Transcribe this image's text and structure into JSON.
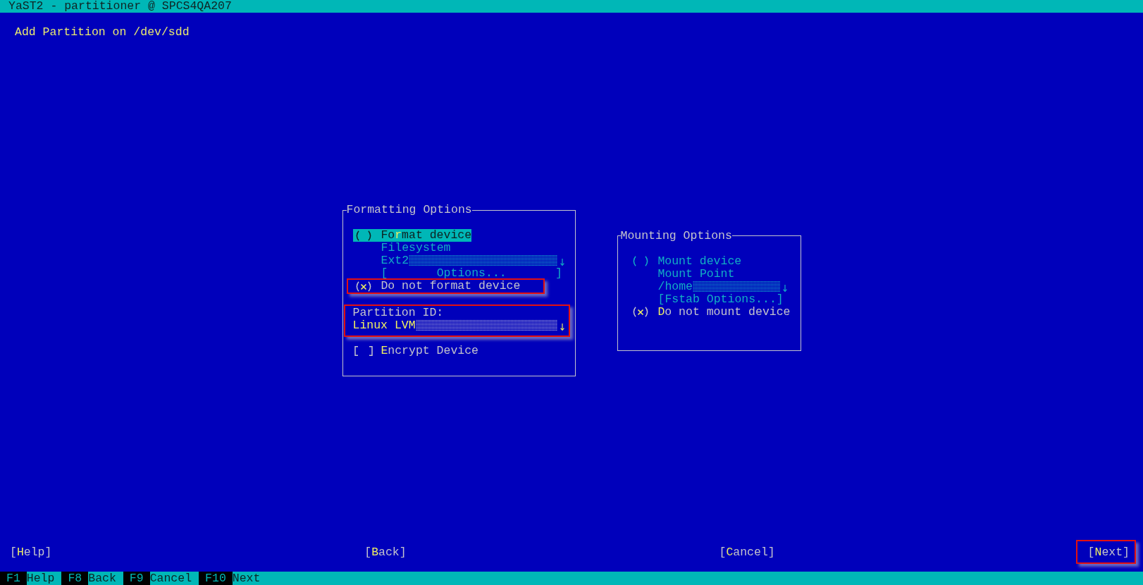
{
  "window": {
    "title": "YaST2 - partitioner @ SPCS4QA207"
  },
  "heading": "Add Partition on /dev/sdd",
  "formatting_options": {
    "title": "Formatting Options",
    "items": [
      {
        "kind": "radio",
        "label": "Fo**r**mat device",
        "selected": false,
        "disabled": false,
        "focused": true,
        "annotated": false,
        "children": [
          {
            "kind": "label",
            "label": "Filesystem",
            "disabled": true
          },
          {
            "kind": "combo",
            "value": "Ext2",
            "disabled": true
          },
          {
            "kind": "button",
            "label": "[       Options...       ]",
            "disabled": true
          }
        ]
      },
      {
        "kind": "radio",
        "label": "Do not format device",
        "selected": true,
        "disabled": false,
        "focused": false,
        "annotated": true
      }
    ],
    "partition_id": {
      "label": "Partition ID:",
      "value": "Linux LVM",
      "disabled": false,
      "annotated": true
    },
    "encrypt": {
      "label": "**E**ncrypt Device",
      "checked": false,
      "disabled": false
    }
  },
  "mounting_options": {
    "title": "Mounting Options",
    "items": [
      {
        "kind": "radio",
        "label": "Mount device",
        "selected": false,
        "disabled": true,
        "focused": false,
        "annotated": false,
        "children": [
          {
            "kind": "label",
            "label": "Mount Point",
            "disabled": true
          },
          {
            "kind": "combo",
            "value": "/home",
            "disabled": true
          },
          {
            "kind": "button",
            "label": "[Fstab Options...]",
            "disabled": true
          }
        ]
      },
      {
        "kind": "radio",
        "label": "**D**o not mount device",
        "selected": true,
        "disabled": false,
        "focused": false,
        "annotated": false
      }
    ]
  },
  "buttons": [
    {
      "label": "[**H**elp]",
      "annotated": false
    },
    {
      "label": "[**B**ack]",
      "annotated": false
    },
    {
      "label": "[**C**ancel]",
      "annotated": false
    },
    {
      "label": "[**N**ext]",
      "annotated": true
    }
  ],
  "function_keys": [
    {
      "key": "F1",
      "label": "Help"
    },
    {
      "key": "F8",
      "label": "Back"
    },
    {
      "key": "F9",
      "label": "Cancel"
    },
    {
      "key": "F10",
      "label": "Next"
    }
  ]
}
